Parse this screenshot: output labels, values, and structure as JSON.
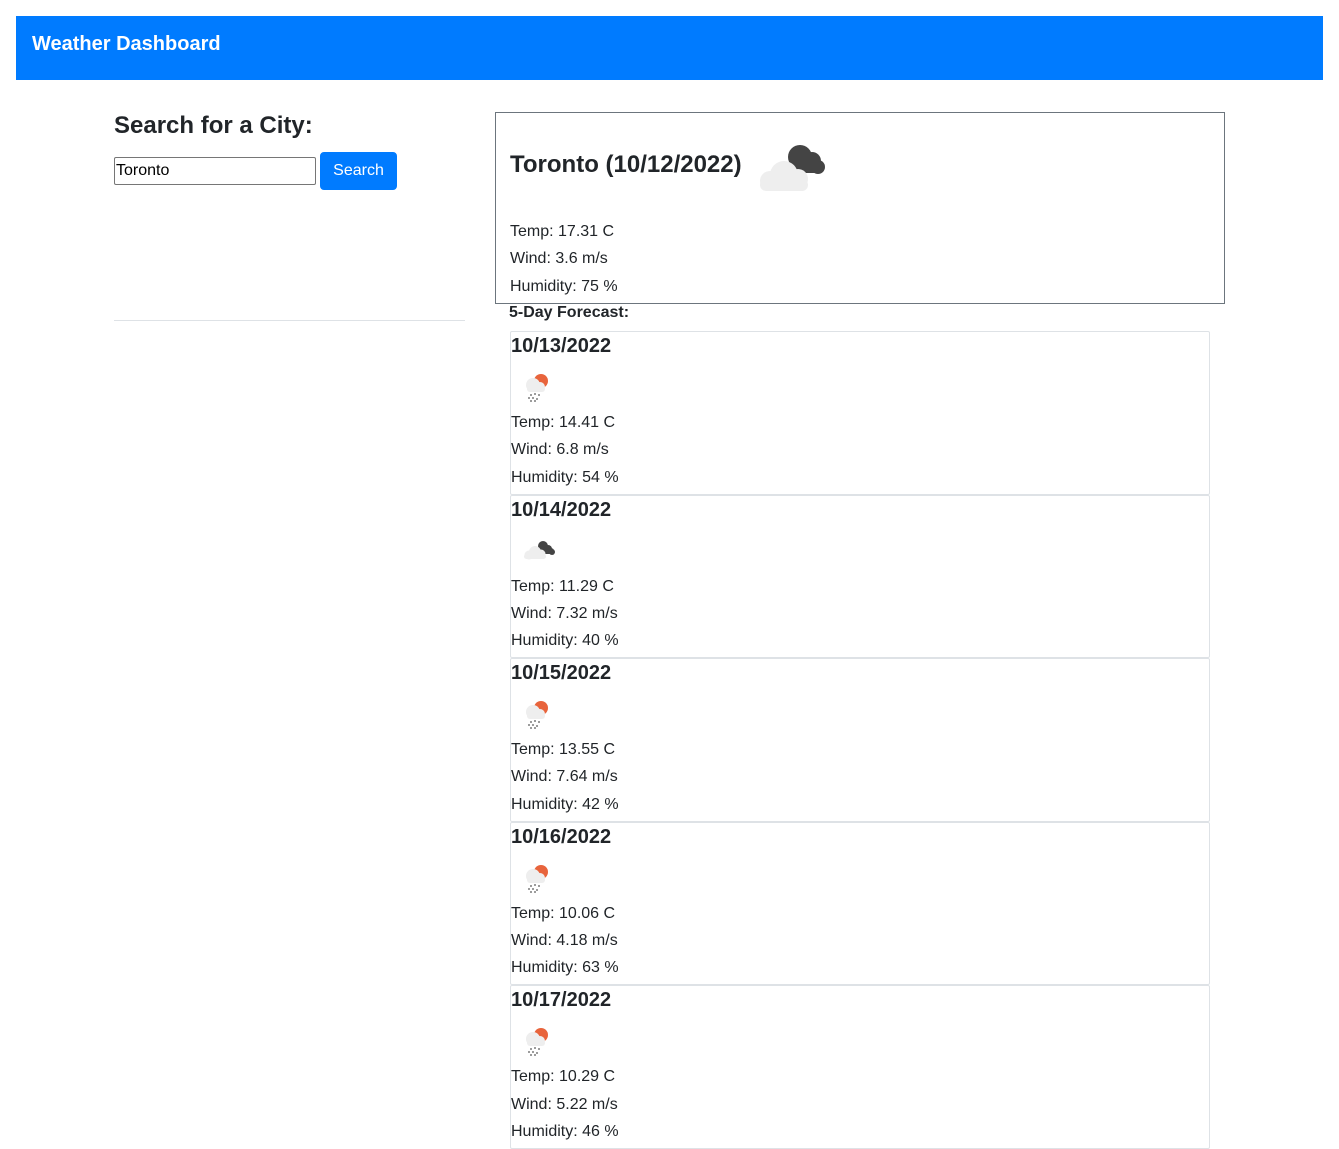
{
  "header": {
    "title": "Weather Dashboard"
  },
  "search": {
    "title": "Search for a City:",
    "input_value": "Toronto",
    "button_label": "Search"
  },
  "current": {
    "heading": "Toronto (10/12/2022)",
    "icon": "broken-clouds-icon",
    "temp": "Temp: 17.31 C",
    "wind": "Wind: 3.6 m/s",
    "humidity": "Humidity: 75 %"
  },
  "forecast": {
    "title": "5-Day Forecast:",
    "days": [
      {
        "date": "10/13/2022",
        "icon": "light-rain-icon",
        "temp": "Temp: 14.41 C",
        "wind": "Wind: 6.8 m/s",
        "humidity": "Humidity: 54 %"
      },
      {
        "date": "10/14/2022",
        "icon": "broken-clouds-icon",
        "temp": "Temp: 11.29 C",
        "wind": "Wind: 7.32 m/s",
        "humidity": "Humidity: 40 %"
      },
      {
        "date": "10/15/2022",
        "icon": "light-rain-icon",
        "temp": "Temp: 13.55 C",
        "wind": "Wind: 7.64 m/s",
        "humidity": "Humidity: 42 %"
      },
      {
        "date": "10/16/2022",
        "icon": "light-rain-icon",
        "temp": "Temp: 10.06 C",
        "wind": "Wind: 4.18 m/s",
        "humidity": "Humidity: 63 %"
      },
      {
        "date": "10/17/2022",
        "icon": "light-rain-icon",
        "temp": "Temp: 10.29 C",
        "wind": "Wind: 5.22 m/s",
        "humidity": "Humidity: 46 %"
      }
    ]
  },
  "colors": {
    "navbar": "#007bff",
    "button": "#007bff",
    "cloud_dark": "#444444",
    "cloud_light": "#eeeeee",
    "sun": "#e8643c"
  }
}
